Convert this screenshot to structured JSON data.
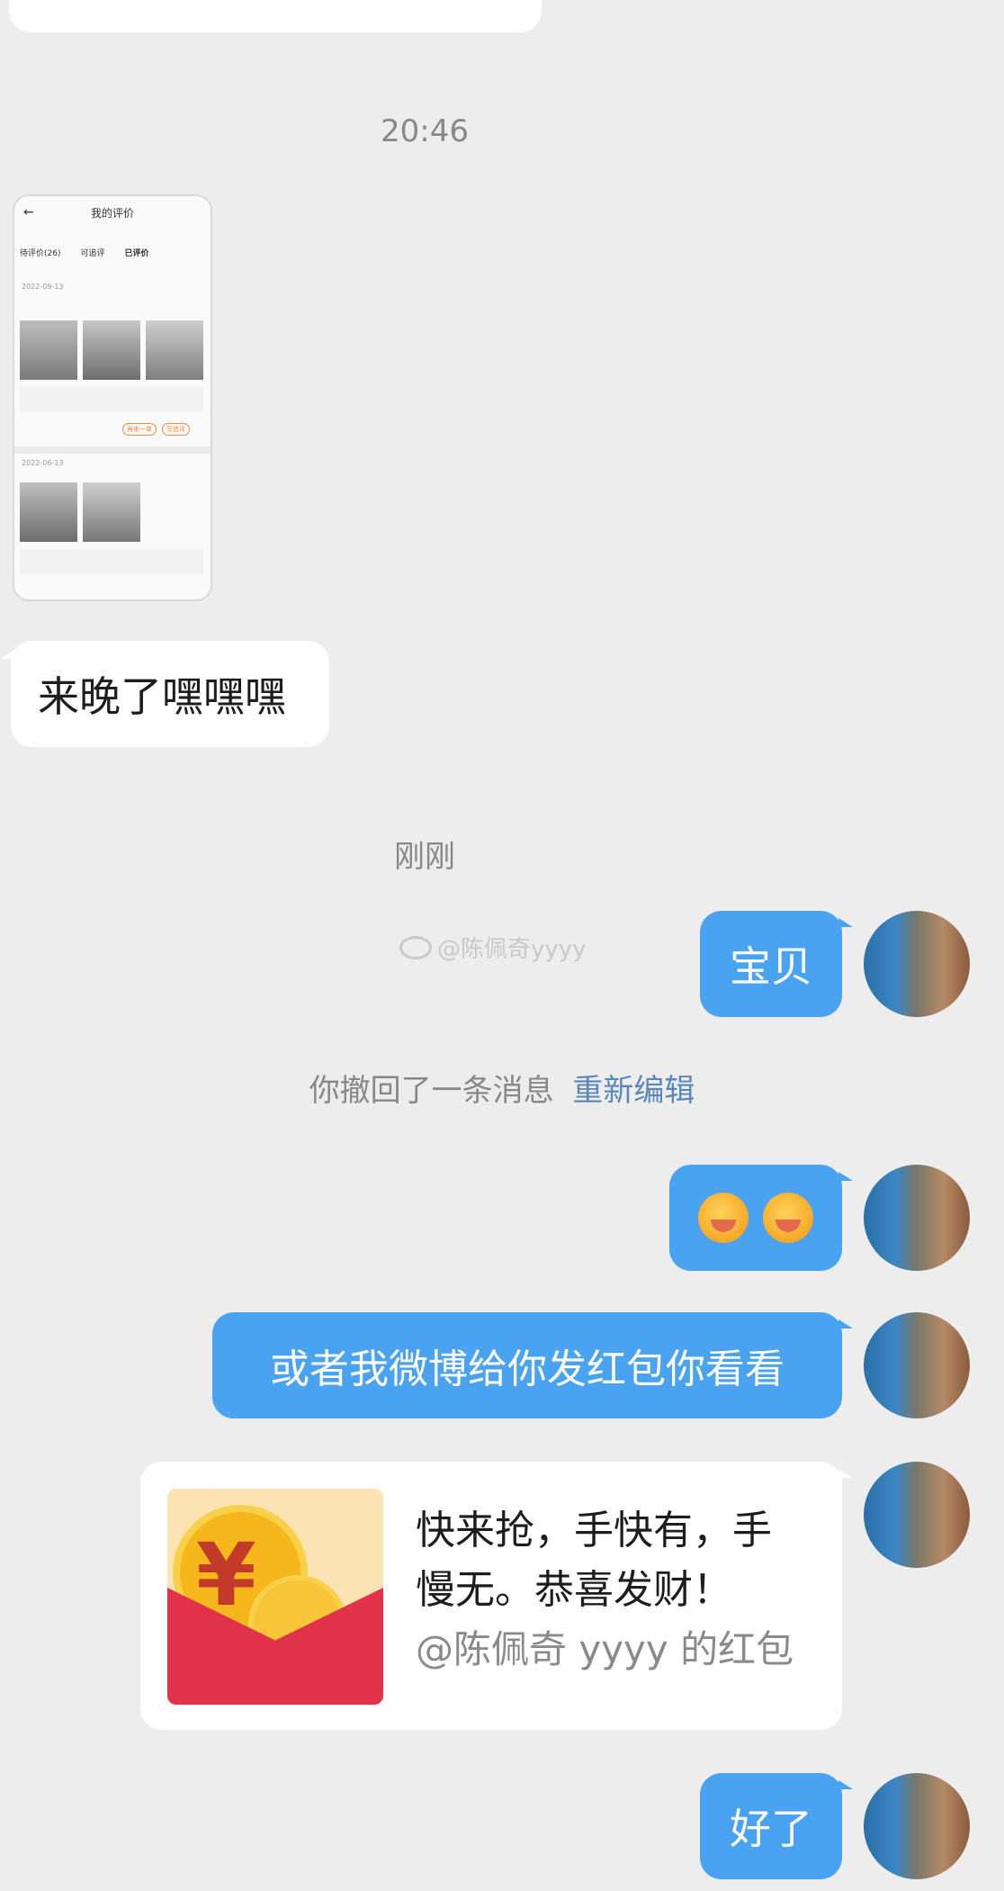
{
  "timestamps": {
    "t1": "20:46",
    "t2": "刚刚"
  },
  "messages": {
    "incoming_text": "来晚了嘿嘿嘿",
    "out_1": "宝贝",
    "recall_notice": "你撤回了一条消息",
    "recall_action": "重新编辑",
    "out_3": "或者我微博给你发红包你看看",
    "red_packet": {
      "line1": "快来抢，手快有，手",
      "line2": "慢无。恭喜发财！",
      "from": "@陈佩奇 yyyy 的红包",
      "symbol": "¥"
    },
    "out_last": "好了"
  },
  "watermark": "@陈佩奇yyyy",
  "screenshot_thumb": {
    "title": "我的评价",
    "tabs": [
      "待评价(26)",
      "可追评",
      "已评价"
    ],
    "date1": "2022-09-13",
    "date2": "2022-06-13",
    "buttons": [
      "再来一单",
      "写追评"
    ]
  },
  "colors": {
    "outgoing_bubble": "#4aa3f0",
    "incoming_bubble": "#ffffff",
    "background": "#ededed",
    "link": "#5b87b8",
    "red_packet": "#e0334a"
  }
}
